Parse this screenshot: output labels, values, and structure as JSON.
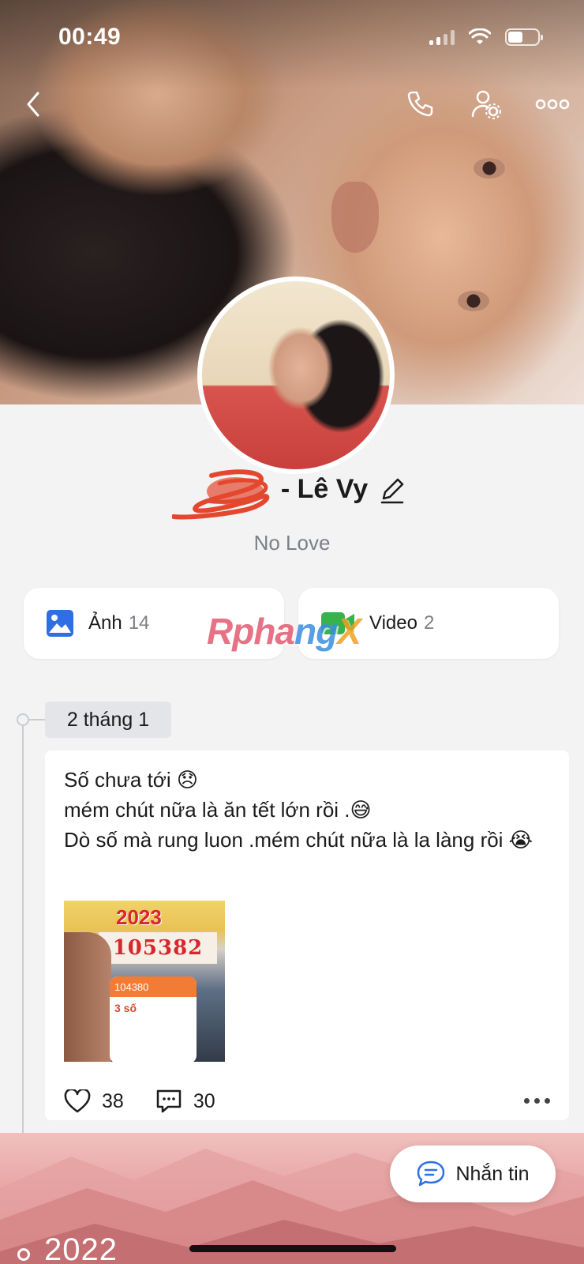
{
  "status_bar": {
    "time": "00:49"
  },
  "profile": {
    "name": "- Lê Vy",
    "bio": "No Love"
  },
  "media": {
    "photos": {
      "label": "Ảnh",
      "count": "14"
    },
    "videos": {
      "label": "Video",
      "count": "2"
    }
  },
  "watermark": {
    "part1": "Rpha",
    "part2": "ng",
    "part3": "X"
  },
  "timeline": {
    "date_label": "2 tháng 1",
    "post": {
      "line1": "Số chưa tới 😞",
      "line2": "mém chút nữa là ăn tết lớn rồi .😅",
      "line3": "Dò số mà rung luon .mém chút nữa là la làng rồi 😭",
      "image": {
        "year_text": "2023",
        "ticket_number": "105382",
        "app_number": "104380",
        "app_label": "3 số"
      },
      "likes": "38",
      "comments": "30"
    },
    "year_label": "2022"
  },
  "message_button": {
    "label": "Nhắn tin"
  },
  "colors": {
    "accent": "#2f6fe4",
    "video_green": "#38b24a",
    "scribble": "#e3482f"
  }
}
